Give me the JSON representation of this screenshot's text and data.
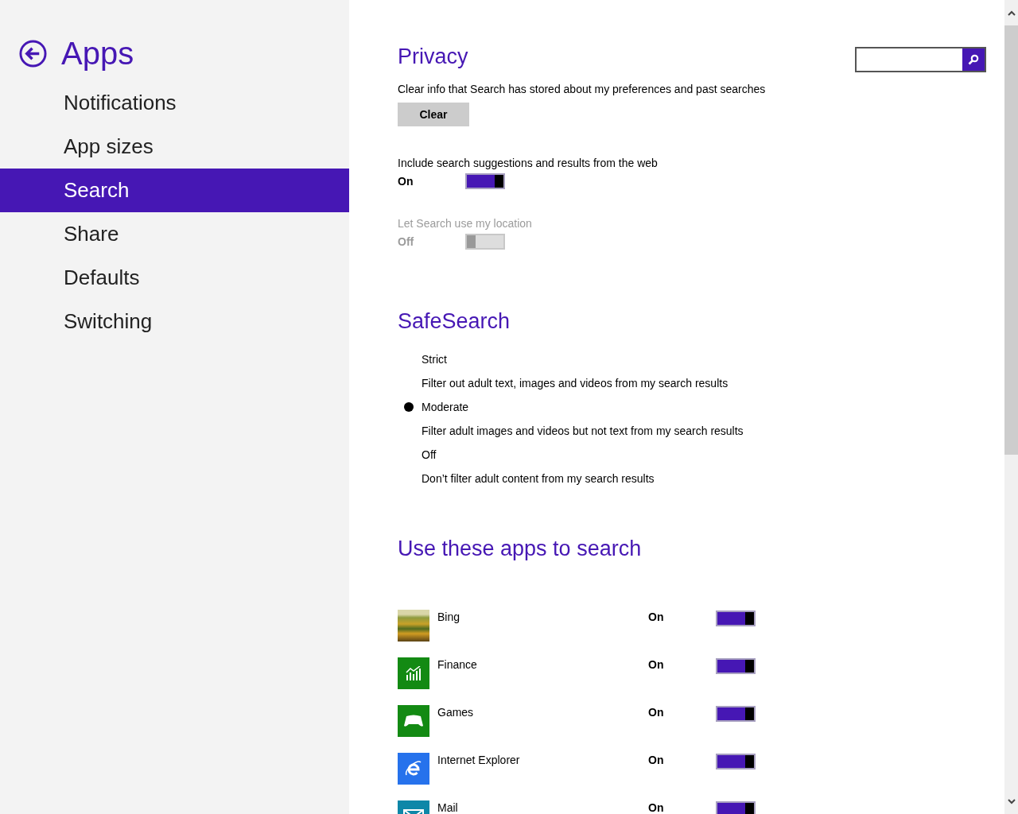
{
  "header": {
    "title": "Apps"
  },
  "sidebar": {
    "items": [
      {
        "label": "Notifications",
        "selected": false
      },
      {
        "label": "App sizes",
        "selected": false
      },
      {
        "label": "Search",
        "selected": true
      },
      {
        "label": "Share",
        "selected": false
      },
      {
        "label": "Defaults",
        "selected": false
      },
      {
        "label": "Switching",
        "selected": false
      }
    ]
  },
  "privacy": {
    "heading": "Privacy",
    "clear_description": "Clear info that Search has stored about my preferences and past searches",
    "clear_button": "Clear",
    "settings": [
      {
        "label": "Include search suggestions and results from the web",
        "state": "On",
        "on": true,
        "disabled": false
      },
      {
        "label": "Let Search use my location",
        "state": "Off",
        "on": false,
        "disabled": true
      }
    ]
  },
  "safesearch": {
    "heading": "SafeSearch",
    "options": [
      {
        "label": "Strict",
        "description": "Filter out adult text, images and videos from my search results",
        "selected": false
      },
      {
        "label": "Moderate",
        "description": "Filter adult images and videos but not text from my search results",
        "selected": true
      },
      {
        "label": "Off",
        "description": "Don’t filter adult content from my search results",
        "selected": false
      }
    ]
  },
  "apps_section": {
    "heading": "Use these apps to search",
    "apps": [
      {
        "name": "Bing",
        "kind": "photo",
        "state": "On",
        "on": true
      },
      {
        "name": "Finance",
        "kind": "finance",
        "color": "#138a13",
        "state": "On",
        "on": true
      },
      {
        "name": "Games",
        "kind": "games",
        "color": "#138a13",
        "state": "On",
        "on": true
      },
      {
        "name": "Internet Explorer",
        "kind": "browser",
        "color": "#2672ec",
        "state": "On",
        "on": true
      },
      {
        "name": "Mail",
        "kind": "mail",
        "color": "#0e87a8",
        "state": "On",
        "on": true
      }
    ]
  }
}
